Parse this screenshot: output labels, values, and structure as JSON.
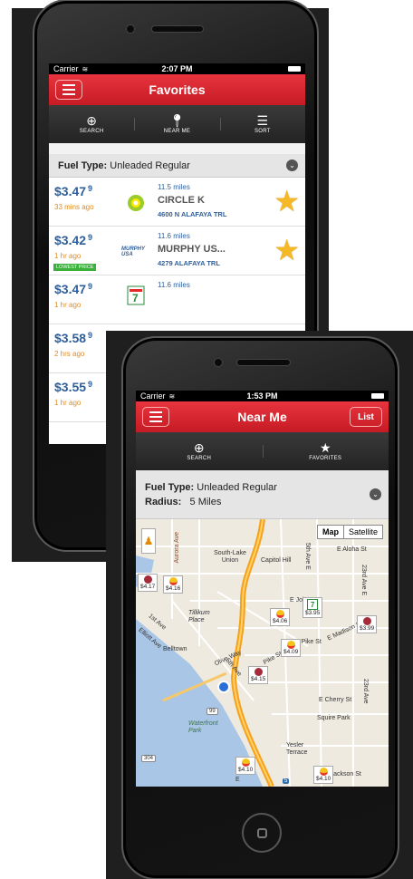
{
  "screen1": {
    "status": {
      "carrier": "Carrier",
      "time": "2:07 PM"
    },
    "nav": {
      "title": "Favorites"
    },
    "toolbar": [
      {
        "icon": "search-icon",
        "glyph": "⊕",
        "label": "SEARCH"
      },
      {
        "icon": "location-pin-icon",
        "glyph": "⬤",
        "label": "NEAR ME"
      },
      {
        "icon": "sort-icon",
        "glyph": "☰",
        "label": "SORT"
      }
    ],
    "filter": {
      "label": "Fuel Type:",
      "value": "Unleaded Regular"
    },
    "rows": [
      {
        "price": "$3.47",
        "tenth": "9",
        "ago": "33 mins ago",
        "brand": "bp",
        "distance": "11.5 miles",
        "name": "CIRCLE K",
        "address": "4600 N ALAFAYA TRL",
        "badge": ""
      },
      {
        "price": "$3.42",
        "tenth": "9",
        "ago": "1 hr ago",
        "brand": "MURPHY USA",
        "distance": "11.6 miles",
        "name": "MURPHY US...",
        "address": "4279 ALAFAYA TRL",
        "badge": "LOWEST PRICE"
      },
      {
        "price": "$3.47",
        "tenth": "9",
        "ago": "1 hr ago",
        "brand": "7",
        "distance": "11.6 miles",
        "name": "",
        "address": "",
        "badge": ""
      },
      {
        "price": "$3.58",
        "tenth": "9",
        "ago": "2 hrs ago",
        "brand": "",
        "distance": "",
        "name": "",
        "address": "",
        "badge": ""
      },
      {
        "price": "$3.55",
        "tenth": "9",
        "ago": "1 hr ago",
        "brand": "",
        "distance": "",
        "name": "",
        "address": "",
        "badge": ""
      }
    ]
  },
  "screen2": {
    "status": {
      "carrier": "Carrier",
      "time": "1:53 PM"
    },
    "nav": {
      "title": "Near Me",
      "right_button": "List"
    },
    "toolbar": [
      {
        "icon": "search-icon",
        "glyph": "⊕",
        "label": "SEARCH"
      },
      {
        "icon": "star-icon",
        "glyph": "★",
        "label": "FAVORITES"
      }
    ],
    "filter": {
      "label": "Fuel Type:",
      "value": "Unleaded Regular",
      "radius_label": "Radius:",
      "radius_value": "5 Miles"
    },
    "map": {
      "type_map": "Map",
      "type_satellite": "Satellite",
      "labels": [
        "South-Lake Union",
        "Capitol Hill",
        "E Aloha St",
        "5th Ave E",
        "23rd Ave E",
        "Aurora Ave",
        "E John St",
        "Tillikum Place",
        "Belltown",
        "Olive Way",
        "Pike St",
        "E Pike St",
        "E Madison St",
        "1st Ave",
        "Elliott Ave",
        "5th Ave",
        "Waterfront Park",
        "E Cherry St",
        "Squire Park",
        "Yesler Terrace",
        "S Jackson St",
        "23rd Ave",
        "99",
        "304",
        "5",
        "E"
      ],
      "pins": [
        {
          "price": "$4.17",
          "brand": "gas"
        },
        {
          "price": "$4.16",
          "brand": "shell"
        },
        {
          "price": "$4.06",
          "brand": "shell"
        },
        {
          "price": "$3.95",
          "brand": "7"
        },
        {
          "price": "$3.99",
          "brand": "gas"
        },
        {
          "price": "$4.09",
          "brand": "shell"
        },
        {
          "price": "$4.15",
          "brand": "gas"
        },
        {
          "price": "$4.10",
          "brand": "shell"
        },
        {
          "price": "$4.10",
          "brand": "shell"
        }
      ]
    }
  },
  "colors": {
    "accent_red": "#d4222b",
    "price_blue": "#2f5f9b",
    "ago_orange": "#e38a1e",
    "star_yellow": "#f5b826",
    "lowest_green": "#3ab13a"
  }
}
